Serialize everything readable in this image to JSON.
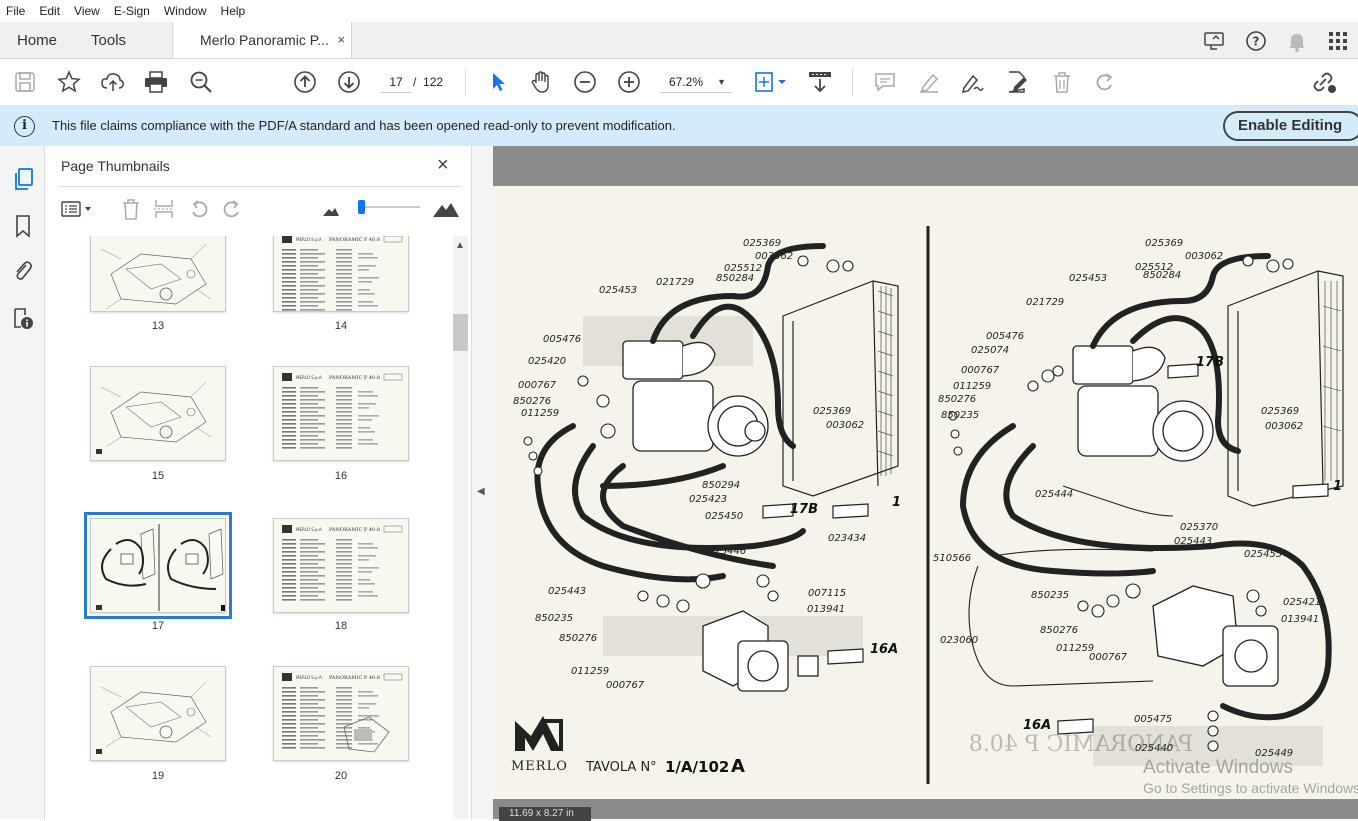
{
  "menu": [
    "File",
    "Edit",
    "View",
    "E-Sign",
    "Window",
    "Help"
  ],
  "tabs": {
    "home": "Home",
    "tools": "Tools",
    "document": "Merlo Panoramic P...",
    "close": "×"
  },
  "toolbar": {
    "current_page": "17",
    "page_separator": "/",
    "total_pages": "122",
    "zoom": "67.2%"
  },
  "info_bar": {
    "message": "This file claims compliance with the PDF/A standard and has been opened read-only to prevent modification.",
    "enable_button": "Enable Editing"
  },
  "thumbnail_panel": {
    "title": "Page Thumbnails",
    "close": "×",
    "pages": [
      {
        "number": "13",
        "kind": "drawing"
      },
      {
        "number": "14",
        "kind": "table"
      },
      {
        "number": "15",
        "kind": "drawing"
      },
      {
        "number": "16",
        "kind": "table"
      },
      {
        "number": "17",
        "kind": "drawing",
        "selected": true
      },
      {
        "number": "18",
        "kind": "table"
      },
      {
        "number": "19",
        "kind": "drawing"
      },
      {
        "number": "20",
        "kind": "table"
      }
    ],
    "thumb_header_text": "PANORAMIC P 40.8",
    "thumb_brand_text": "MERLO S.p.A."
  },
  "document_page": {
    "left_labels": [
      "025369",
      "003062",
      "025512",
      "850284",
      "025453",
      "021729",
      "005476",
      "025420",
      "000767",
      "850276",
      "011259",
      "025369",
      "003062",
      "850294",
      "025423",
      "025450",
      "17B",
      "1",
      "023434",
      "025446",
      "007115",
      "013941",
      "025443",
      "850235",
      "850276",
      "011259",
      "000767",
      "16A"
    ],
    "right_labels": [
      "025369",
      "003062",
      "025512",
      "850284",
      "025453",
      "021729",
      "005476",
      "025074",
      "000767",
      "011259",
      "850276",
      "850235",
      "17B",
      "025369",
      "003062",
      "025444",
      "1",
      "025370",
      "025443",
      "510566",
      "025455",
      "850235",
      "025421",
      "013941",
      "850276",
      "011259",
      "000767",
      "023060",
      "16A",
      "005475",
      "025440",
      "025449"
    ],
    "brand": "MERLO",
    "plate": "TAVOLA N°",
    "plate_number": "1/A/102",
    "plate_suffix": "A"
  },
  "status": {
    "page_size": "11.69 x 8.27 in"
  },
  "watermark": {
    "line1": "Activate Windows",
    "line2": "Go to Settings to activate Windows."
  }
}
